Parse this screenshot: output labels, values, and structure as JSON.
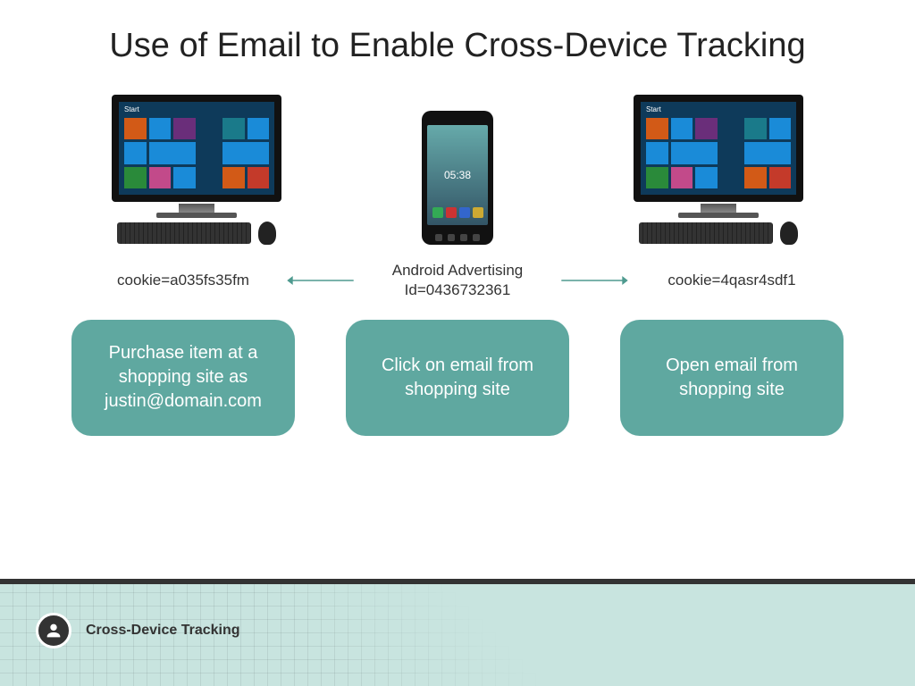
{
  "title": "Use of Email to Enable Cross-Device Tracking",
  "devices": {
    "left_screen_label": "Start",
    "right_screen_label": "Start",
    "phone_time": "05:38"
  },
  "identifiers": {
    "left": "cookie=a035fs35fm",
    "center_line1": "Android Advertising",
    "center_line2": "Id=0436732361",
    "right": "cookie=4qasr4sdf1"
  },
  "steps": {
    "left": "Purchase item at a shopping site as justin@domain.com",
    "center": "Click on email from shopping site",
    "right": "Open email from shopping site"
  },
  "footer": {
    "label": "Cross-Device Tracking"
  },
  "colors": {
    "step_bg": "#5fa8a0",
    "footer_bg": "#c8e4df",
    "arrow": "#4e9a8f"
  }
}
